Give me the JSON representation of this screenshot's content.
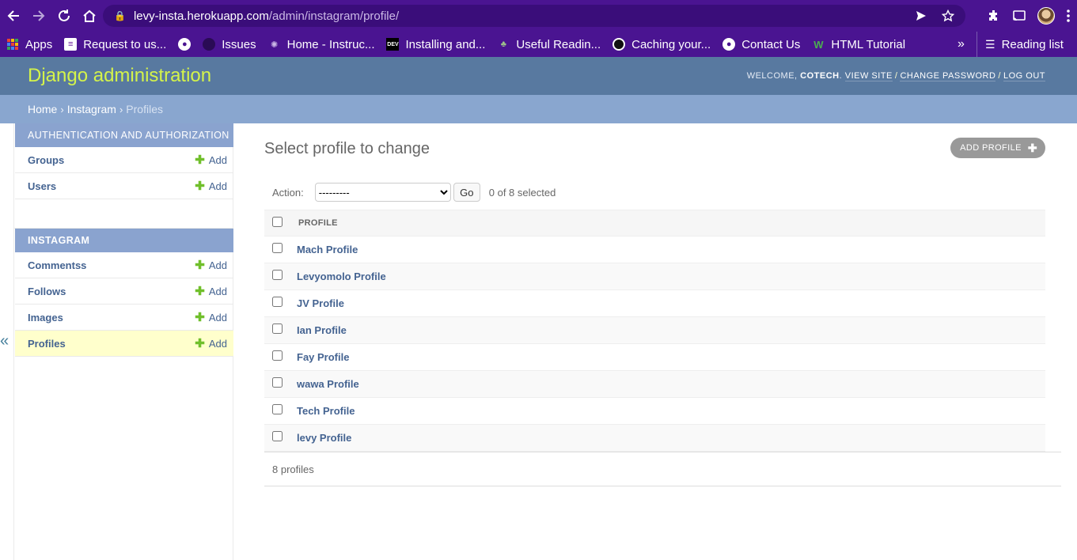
{
  "browser": {
    "url_host": "levy-insta.herokuapp.com",
    "url_path": "/admin/instagram/profile/",
    "bookmarks": [
      {
        "label": "Apps",
        "icon": "apps-grid-icon"
      },
      {
        "label": "Request to us...",
        "icon": "list-icon"
      },
      {
        "label": "",
        "icon": "globe-icon"
      },
      {
        "label": "Issues",
        "icon": "circle-icon"
      },
      {
        "label": "Home - Instruc...",
        "icon": "gear-icon"
      },
      {
        "label": "Installing and...",
        "icon": "dev-icon"
      },
      {
        "label": "Useful Readin...",
        "icon": "palm-icon"
      },
      {
        "label": "Caching your...",
        "icon": "github-icon"
      },
      {
        "label": "Contact Us",
        "icon": "globe-icon"
      },
      {
        "label": "HTML Tutorial",
        "icon": "w-icon"
      }
    ],
    "more_label": "»",
    "reading_list": "Reading list"
  },
  "header": {
    "site_name": "Django administration",
    "welcome": "WELCOME,",
    "username": "COTECH",
    "view_site": "VIEW SITE",
    "change_password": "CHANGE PASSWORD",
    "log_out": "LOG OUT"
  },
  "breadcrumbs": {
    "home": "Home",
    "app": "Instagram",
    "current": "Profiles",
    "sep": "›"
  },
  "sidebar": {
    "auth_caption": "Authentication and Authorization",
    "auth_items": [
      {
        "label": "Groups",
        "add": "Add"
      },
      {
        "label": "Users",
        "add": "Add"
      }
    ],
    "insta_caption": "Instagram",
    "insta_items": [
      {
        "label": "Commentss",
        "add": "Add"
      },
      {
        "label": "Follows",
        "add": "Add"
      },
      {
        "label": "Images",
        "add": "Add"
      },
      {
        "label": "Profiles",
        "add": "Add",
        "current": true
      }
    ],
    "collapse": "«"
  },
  "content": {
    "title": "Select profile to change",
    "add_button": "Add profile",
    "action_label": "Action:",
    "action_selected": "---------",
    "go_label": "Go",
    "selected_count": "0 of 8 selected",
    "column_header": "Profile",
    "rows": [
      "Mach Profile",
      "Levyomolo Profile",
      "JV Profile",
      "Ian Profile",
      "Fay Profile",
      "wawa Profile",
      "Tech Profile",
      "levy Profile"
    ],
    "paginator": "8 profiles"
  },
  "colors": {
    "browser_bg": "#4a1491",
    "header_bg": "#5879a0",
    "branding": "#d4f34a",
    "breadcrumb_bg": "#89a6cf",
    "link": "#446391",
    "add_plus": "#70bf2b",
    "current_row": "#ffffcc"
  }
}
